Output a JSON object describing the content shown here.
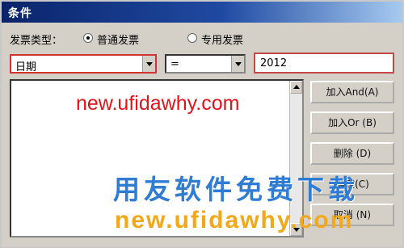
{
  "window": {
    "title": "条件"
  },
  "invoice_type": {
    "label": "发票类型：",
    "options": [
      {
        "label": "普通发票",
        "selected": true
      },
      {
        "label": "专用发票",
        "selected": false
      }
    ]
  },
  "filter": {
    "field": "日期",
    "operator": "=",
    "value": "2012"
  },
  "buttons": {
    "add_and": "加入And(A)",
    "add_or": "加入Or (B)",
    "delete": "删除 (D)",
    "ok": "确定(C)",
    "cancel": "取消 (N)"
  },
  "watermarks": {
    "site_top": "new.ufidawhy.com",
    "promo": "用友软件免费下载",
    "site_bottom": "new.ufidawhy.com"
  },
  "colors": {
    "title_bar": "#0a246a",
    "dialog_bg": "#d4d0c8",
    "watermark_red": "#e4121a",
    "watermark_blue": "#2f7cd4",
    "watermark_orange": "#f2a81a"
  }
}
